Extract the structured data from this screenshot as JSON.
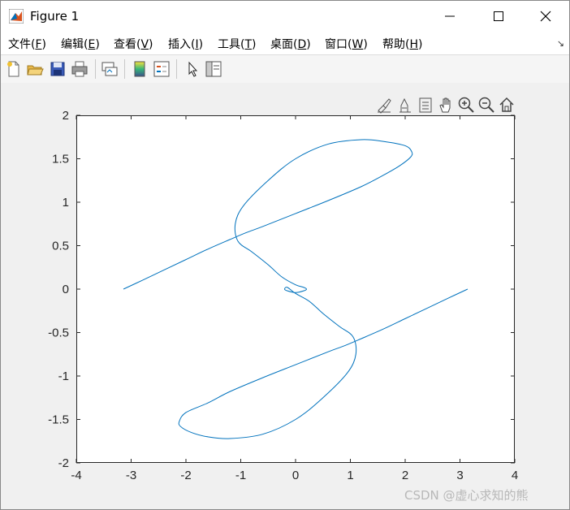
{
  "window": {
    "title": "Figure 1",
    "controls": [
      "minimize",
      "maximize",
      "close"
    ]
  },
  "menu": [
    {
      "text": "文件(",
      "key": "F",
      "close": ")"
    },
    {
      "text": "编辑(",
      "key": "E",
      "close": ")"
    },
    {
      "text": "查看(",
      "key": "V",
      "close": ")"
    },
    {
      "text": "插入(",
      "key": "I",
      "close": ")"
    },
    {
      "text": "工具(",
      "key": "T",
      "close": ")"
    },
    {
      "text": "桌面(",
      "key": "D",
      "close": ")"
    },
    {
      "text": "窗口(",
      "key": "W",
      "close": ")"
    },
    {
      "text": "帮助(",
      "key": "H",
      "close": ")"
    }
  ],
  "toolbar_icons": [
    "new-figure-icon",
    "open-file-icon",
    "save-icon",
    "print-icon",
    "link-plot-icon",
    "insert-colorbar-icon",
    "insert-legend-icon",
    "edit-plot-arrow-icon",
    "property-inspector-icon"
  ],
  "axes_toolbar_icons": [
    "brush-icon",
    "data-cursor-icon",
    "data-tips-icon",
    "pan-icon",
    "zoom-in-icon",
    "zoom-out-icon",
    "restore-view-icon"
  ],
  "chart_data": {
    "type": "line",
    "title": "",
    "xlabel": "",
    "ylabel": "",
    "xlim": [
      -4,
      4
    ],
    "ylim": [
      -2,
      2
    ],
    "xticks": [
      -4,
      -3,
      -2,
      -1,
      0,
      1,
      2,
      3,
      4
    ],
    "yticks": [
      -2,
      -1.5,
      -1,
      -0.5,
      0,
      0.5,
      1,
      1.5,
      2
    ],
    "xtick_labels": [
      "-4",
      "-3",
      "-2",
      "-1",
      "0",
      "1",
      "2",
      "3",
      "4"
    ],
    "ytick_labels": [
      "-2",
      "-1.5",
      "-1",
      "-0.5",
      "0",
      "0.5",
      "1",
      "1.5",
      "2"
    ],
    "grid": false,
    "line_color": "#0072bd",
    "series": [
      {
        "x": [
          -3.14,
          -2.8,
          -2.4,
          -2.0,
          -1.6,
          -1.2,
          -0.9,
          -0.6,
          0.0,
          0.6,
          1.2,
          1.6,
          1.9,
          2.1,
          2.12,
          2.0,
          1.6,
          1.2,
          0.6,
          0.0,
          -0.5,
          -0.95,
          -1.1,
          -1.05,
          -0.8,
          -0.5,
          -0.25,
          0.0,
          0.15,
          0.2,
          0.15,
          0.0,
          -0.15,
          -0.2,
          -0.15,
          0.0,
          0.25,
          0.5,
          0.8,
          1.05,
          1.1,
          0.95,
          0.5,
          0.0,
          -0.6,
          -1.2,
          -1.6,
          -1.9,
          -2.1,
          -2.12,
          -2.0,
          -1.6,
          -1.2,
          -0.6,
          0.0,
          0.6,
          0.9,
          1.2,
          1.6,
          2.0,
          2.4,
          2.8,
          3.14
        ],
        "y": [
          0.0,
          0.1,
          0.22,
          0.34,
          0.46,
          0.57,
          0.65,
          0.72,
          0.87,
          1.02,
          1.18,
          1.31,
          1.42,
          1.52,
          1.58,
          1.65,
          1.7,
          1.72,
          1.67,
          1.5,
          1.25,
          0.96,
          0.75,
          0.55,
          0.43,
          0.28,
          0.14,
          0.05,
          0.02,
          0.0,
          -0.02,
          -0.04,
          -0.02,
          0.0,
          0.02,
          -0.05,
          -0.14,
          -0.28,
          -0.43,
          -0.55,
          -0.75,
          -0.96,
          -1.25,
          -1.5,
          -1.67,
          -1.72,
          -1.7,
          -1.65,
          -1.58,
          -1.52,
          -1.42,
          -1.31,
          -1.18,
          -1.02,
          -0.87,
          -0.72,
          -0.65,
          -0.57,
          -0.46,
          -0.34,
          -0.22,
          -0.1,
          0.0
        ]
      }
    ]
  },
  "watermark": "CSDN @虚心求知的熊"
}
